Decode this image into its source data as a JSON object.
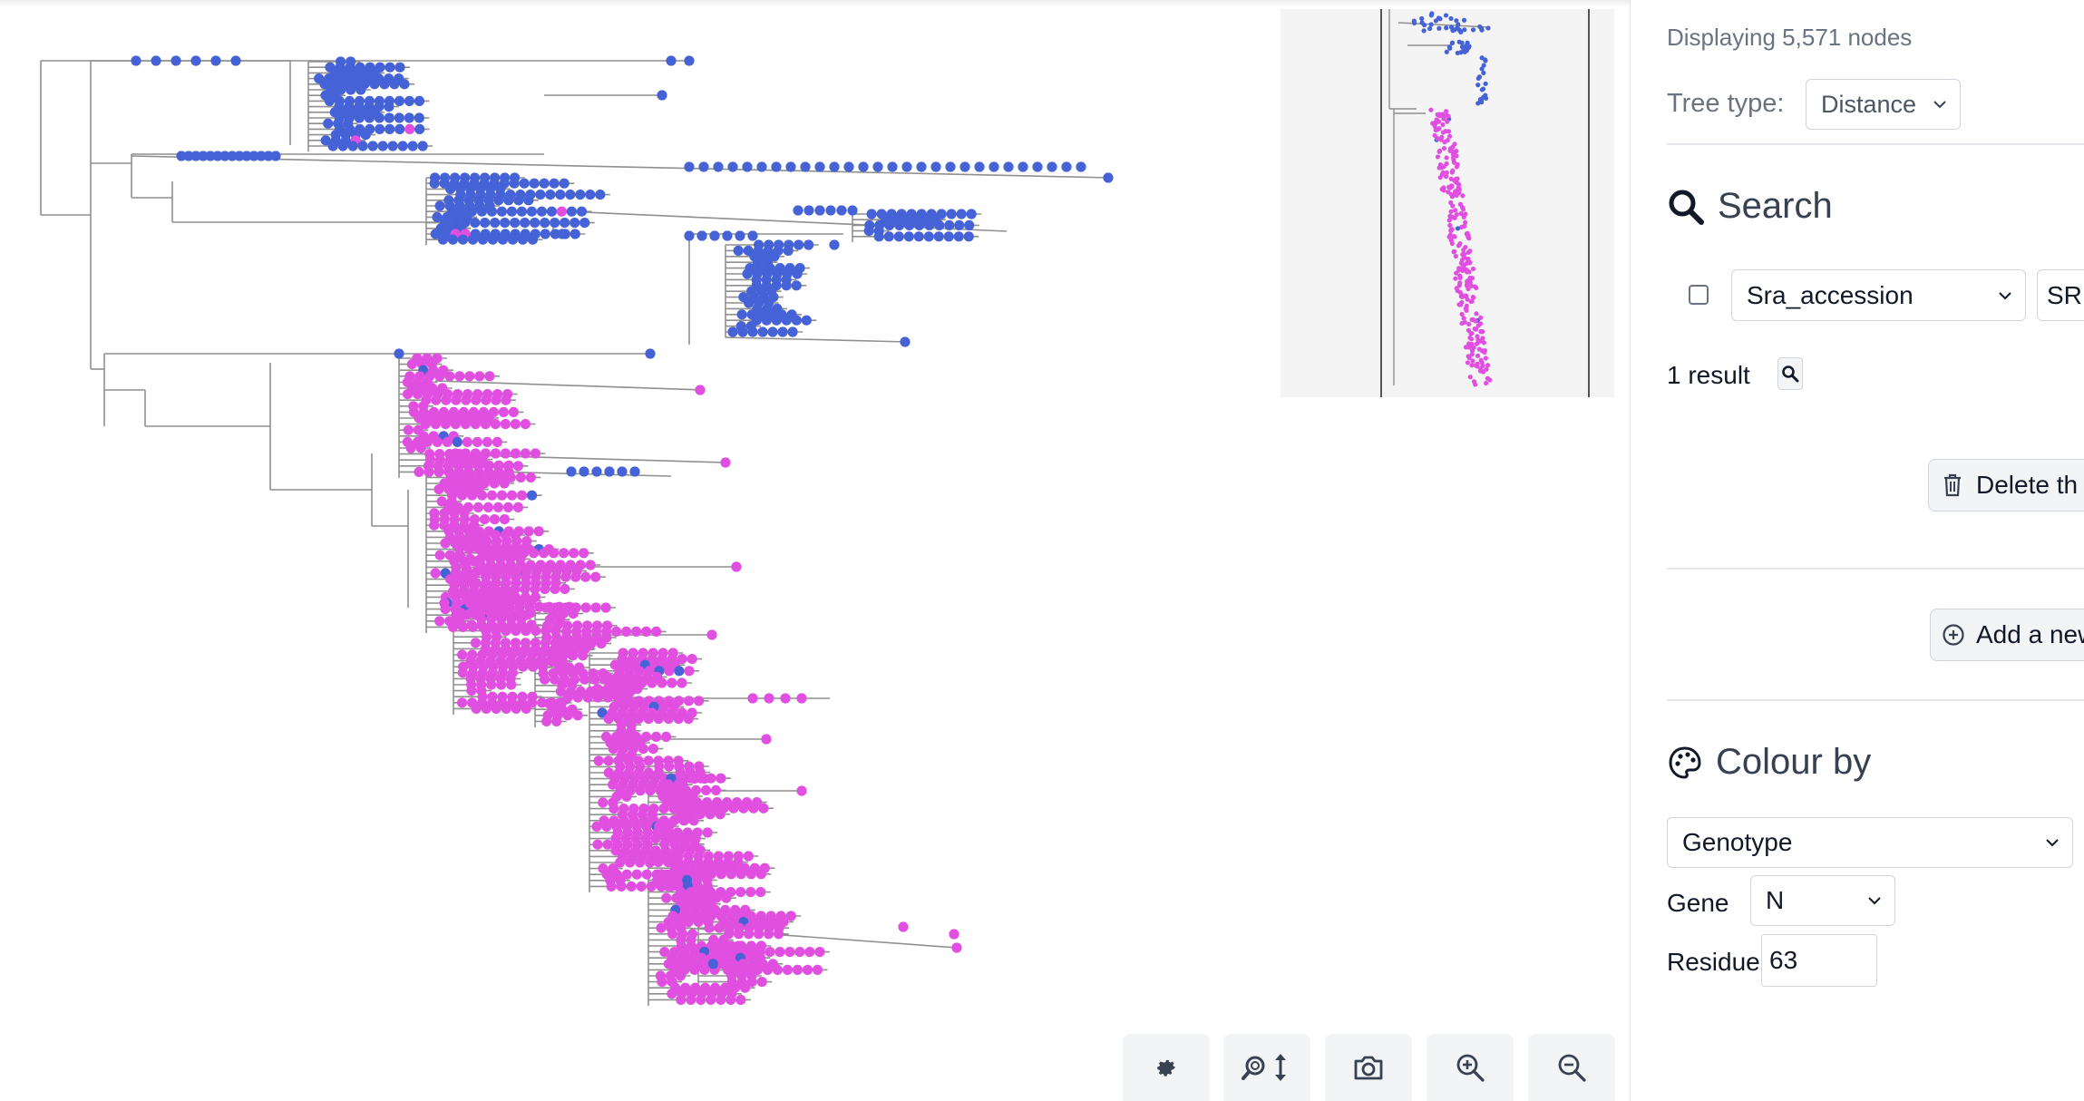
{
  "tree": {
    "colors": {
      "genotype_a": "#4562d6",
      "genotype_b": "#e04fe0",
      "branch": "#8f8f8f"
    },
    "description": "phylogenetic tree with two large clades"
  },
  "sidebar": {
    "nodes_count": "Displaying 5,571 nodes",
    "tree_type_label": "Tree type:",
    "tree_type_value": "Distance",
    "search_heading": "Search",
    "search_field": "Sra_accession",
    "search_value": "SRR",
    "result_count": "1 result",
    "delete_button": "Delete th",
    "add_button": "Add a new",
    "colour_heading": "Colour by",
    "colour_by": "Genotype",
    "gene_label": "Gene",
    "gene_value": "N",
    "residue_label": "Residue",
    "residue_value": "63"
  },
  "controls": {
    "icons": [
      "gear-icon",
      "zoom-vertical-icon",
      "camera-icon",
      "zoom-in-icon",
      "zoom-out-icon"
    ]
  }
}
